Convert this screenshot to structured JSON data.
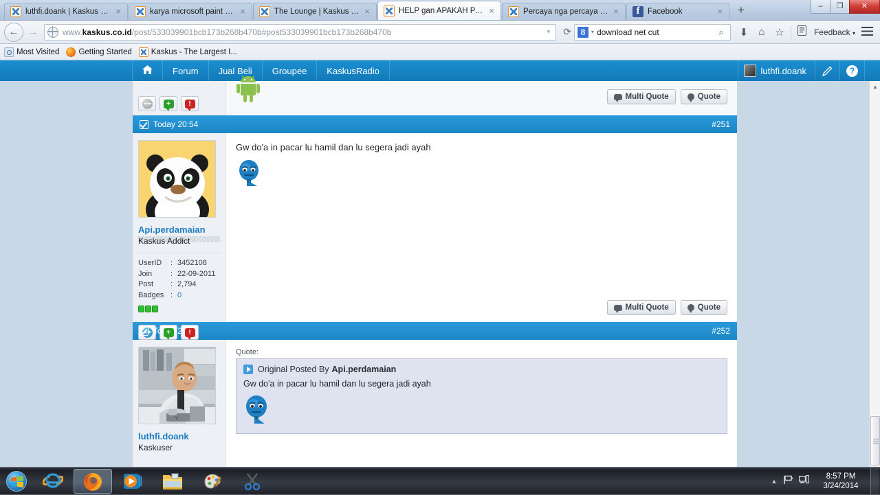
{
  "browser": {
    "tabs": [
      {
        "title": "luthfi.doank | Kaskus - T...",
        "favicon": "kaskus-icon",
        "active": false
      },
      {
        "title": "karya microsoft paint an...",
        "favicon": "kaskus-icon",
        "active": false
      },
      {
        "title": "The Lounge | Kaskus - T...",
        "favicon": "kaskus-icon",
        "active": false
      },
      {
        "title": "HELP gan APAKAH PAC...",
        "favicon": "kaskus-icon",
        "active": true
      },
      {
        "title": "Percaya nga percaya 9 k...",
        "favicon": "kaskus-icon",
        "active": false
      },
      {
        "title": "Facebook",
        "favicon": "facebook-icon",
        "active": false
      }
    ],
    "new_tab_label": "+",
    "close_glyph": "×",
    "window_controls": {
      "minimize": "–",
      "maximize": "❐",
      "close": "✕"
    },
    "nav": {
      "back_glyph": "←",
      "forward_glyph": "→",
      "reload_glyph": "⟳",
      "url_dropdown_glyph": "▾",
      "url_prefix": "www.",
      "url_domain": "kaskus.co.id",
      "url_path": "/post/533039901bcb173b268b470b#post533039901bcb173b268b470b",
      "download_glyph": "⬇",
      "home_glyph": "⌂",
      "bookmark_glyph": "☆",
      "library_glyph": "Ὄb",
      "feedback_label": "Feedback",
      "feedback_caret": "▾",
      "menu_glyph": "☰"
    },
    "search": {
      "engine_letter": "8",
      "caret": "▾",
      "value": "download net cut",
      "go_glyph": "⌕"
    },
    "bookmarks": [
      {
        "label": "Most Visited",
        "icon": "most-visited-icon"
      },
      {
        "label": "Getting Started",
        "icon": "firefox-icon"
      },
      {
        "label": "Kaskus - The Largest I...",
        "icon": "kaskus-icon"
      }
    ]
  },
  "site_nav": {
    "home_glyph": "⌂",
    "items": [
      "Forum",
      "Jual Beli",
      "Groupee",
      "KaskusRadio"
    ],
    "username": "luthfi.doank",
    "edit_glyph": "✎",
    "help_glyph": "?"
  },
  "posts": [
    {
      "header": {
        "timestamp": "Today 20:54",
        "number": "#251"
      },
      "user": {
        "name": "Api.perdamaian",
        "title": "Kaskus Addict",
        "avatar": "kung-fu-panda-avatar",
        "stats": [
          {
            "label": "UserID",
            "value": "3452108",
            "link": false
          },
          {
            "label": "Join",
            "value": "22-09-2011",
            "link": false
          },
          {
            "label": "Post",
            "value": "2,794",
            "link": false
          },
          {
            "label": "Badges",
            "value": "0",
            "link": true
          }
        ],
        "badge_count": 3
      },
      "text": "Gw do'a in pacar lu hamil dan lu segera jadi ayah",
      "smiley": "bored-blue-smiley",
      "buttons": {
        "multi_quote": "Multi Quote",
        "quote": "Quote"
      }
    },
    {
      "header": {
        "timestamp": "Today 20:56",
        "number": "#252"
      },
      "user": {
        "name": "luthfi.doank",
        "title": "Kaskuser",
        "avatar": "man-at-desk-avatar"
      },
      "quote": {
        "label": "Quote:",
        "attribution_prefix": "Original Posted By",
        "attribution_user": "Api.perdamaian",
        "text": "Gw do'a in pacar lu hamil dan lu segera jadi ayah",
        "smiley": "bored-blue-smiley"
      }
    }
  ],
  "top_partial_post": {
    "image": "android-robot-icon",
    "buttons": {
      "multi_quote": "Multi Quote",
      "quote": "Quote"
    }
  },
  "scrollbar": {
    "up_glyph": "▲",
    "down_glyph": "▼"
  },
  "taskbar": {
    "start": "windows-start-orb",
    "items": [
      {
        "name": "internet-explorer-icon",
        "active": false
      },
      {
        "name": "firefox-icon",
        "active": true
      },
      {
        "name": "windows-media-player-icon",
        "active": false
      },
      {
        "name": "file-explorer-icon",
        "active": false
      },
      {
        "name": "paint-icon",
        "active": false
      },
      {
        "name": "snipping-tool-icon",
        "active": false
      }
    ],
    "tray": {
      "expand_glyph": "▲",
      "flag_glyph": "⚑",
      "network_glyph": "▣"
    },
    "clock": {
      "time": "8:57 PM",
      "date": "3/24/2014"
    }
  },
  "colors": {
    "kaskus_blue": "#1a8fd1",
    "link_blue": "#1d7dc4",
    "quote_bg": "#dfe3ef"
  }
}
